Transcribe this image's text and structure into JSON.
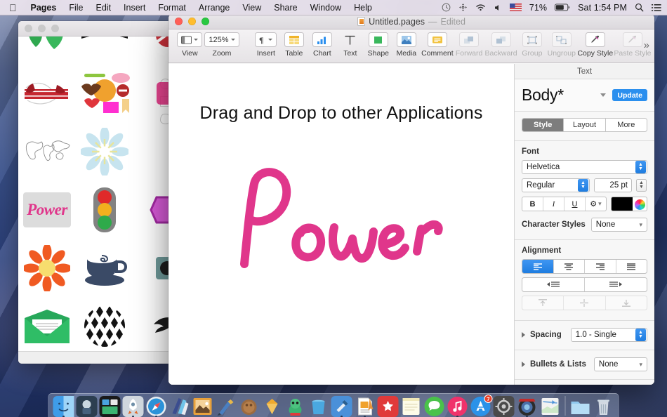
{
  "menubar": {
    "apple_icon": "apple-icon",
    "items": [
      {
        "label": "Pages",
        "bold": true
      },
      {
        "label": "File",
        "bold": false
      },
      {
        "label": "Edit",
        "bold": false
      },
      {
        "label": "Insert",
        "bold": false
      },
      {
        "label": "Format",
        "bold": false
      },
      {
        "label": "Arrange",
        "bold": false
      },
      {
        "label": "View",
        "bold": false
      },
      {
        "label": "Share",
        "bold": false
      },
      {
        "label": "Window",
        "bold": false
      },
      {
        "label": "Help",
        "bold": false
      }
    ],
    "status": {
      "timemachine_icon": "time-machine-icon",
      "sync_icon": "sync-icon",
      "wifi_icon": "wifi-icon",
      "volume_icon": "volume-icon",
      "flag_icon": "us-flag-icon",
      "battery_percent": "71%",
      "battery_icon": "battery-icon",
      "clock": "Sat 1:54 PM",
      "search_icon": "search-icon",
      "notifications_icon": "notification-list-icon"
    }
  },
  "clipart_window": {
    "title": "",
    "items": [
      {
        "name": "green-leaves-clipart"
      },
      {
        "name": "discount-banner-clipart"
      },
      {
        "name": "red-ribbon-clipart"
      },
      {
        "name": "badges-labels-clipart"
      },
      {
        "name": "world-map-outline-clipart"
      },
      {
        "name": "light-blue-flower-clipart"
      },
      {
        "name": "power-script-clipart",
        "selected": true
      },
      {
        "name": "traffic-light-clipart"
      },
      {
        "name": "orange-flower-clipart"
      },
      {
        "name": "coffee-cup-clipart"
      },
      {
        "name": "green-envelope-clipart"
      },
      {
        "name": "checkered-sphere-clipart"
      }
    ]
  },
  "pages_window": {
    "title": {
      "filename": "Untitled.pages",
      "dash": "—",
      "state": "Edited"
    },
    "toolbar": {
      "items": [
        {
          "label": "View",
          "icon": "view-panels-icon",
          "type": "menu",
          "enabled": true
        },
        {
          "label": "Zoom",
          "icon": "zoom-value",
          "type": "menu",
          "enabled": true,
          "value": "125%"
        },
        {
          "label": "Insert",
          "icon": "paragraph-icon",
          "type": "menu",
          "enabled": true
        },
        {
          "label": "Table",
          "icon": "table-icon",
          "type": "button",
          "enabled": true
        },
        {
          "label": "Chart",
          "icon": "chart-bar-icon",
          "type": "button",
          "enabled": true
        },
        {
          "label": "Text",
          "icon": "text-t-icon",
          "type": "button",
          "enabled": true
        },
        {
          "label": "Shape",
          "icon": "shape-square-icon",
          "type": "button",
          "enabled": true
        },
        {
          "label": "Media",
          "icon": "media-photo-icon",
          "type": "button",
          "enabled": true
        },
        {
          "label": "Comment",
          "icon": "comment-icon",
          "type": "button",
          "enabled": true
        },
        {
          "label": "Forward",
          "icon": "bring-forward-icon",
          "type": "button",
          "enabled": false
        },
        {
          "label": "Backward",
          "icon": "send-backward-icon",
          "type": "button",
          "enabled": false
        },
        {
          "label": "Group",
          "icon": "group-icon",
          "type": "button",
          "enabled": false
        },
        {
          "label": "Ungroup",
          "icon": "ungroup-icon",
          "type": "button",
          "enabled": false
        },
        {
          "label": "Copy Style",
          "icon": "eyedropper-copy-icon",
          "type": "button",
          "enabled": true
        },
        {
          "label": "Paste Style",
          "icon": "eyedropper-paste-icon",
          "type": "button",
          "enabled": false
        }
      ],
      "overflow_label": "»"
    },
    "document": {
      "heading": "Drag and Drop to other Applications",
      "artwork_name": "power-script-artwork",
      "artwork_text": "Power",
      "artwork_color": "#e0368b"
    }
  },
  "inspector": {
    "tab_label": "Text",
    "paragraph_style": "Body*",
    "update_label": "Update",
    "segments": [
      {
        "label": "Style",
        "active": true
      },
      {
        "label": "Layout",
        "active": false
      },
      {
        "label": "More",
        "active": false
      }
    ],
    "font": {
      "section_label": "Font",
      "family": "Helvetica",
      "weight": "Regular",
      "size": "25 pt",
      "bold_label": "B",
      "italic_label": "I",
      "underline_label": "U",
      "options_icon": "gear-icon",
      "color": "#000000",
      "color_wheel_icon": "color-wheel-icon",
      "character_styles_label": "Character Styles",
      "character_styles_value": "None"
    },
    "alignment": {
      "section_label": "Alignment",
      "horizontal": [
        {
          "name": "align-left-button",
          "active": true
        },
        {
          "name": "align-center-button",
          "active": false
        },
        {
          "name": "align-right-button",
          "active": false
        },
        {
          "name": "align-justify-button",
          "active": false
        }
      ],
      "indent": [
        {
          "name": "decrease-indent-button"
        },
        {
          "name": "increase-indent-button"
        }
      ],
      "vertical": [
        {
          "name": "align-top-button"
        },
        {
          "name": "align-middle-button"
        },
        {
          "name": "align-bottom-button"
        }
      ]
    },
    "spacing": {
      "label": "Spacing",
      "value": "1.0 - Single"
    },
    "bullets": {
      "label": "Bullets & Lists",
      "value": "None"
    }
  },
  "dock": {
    "items": [
      {
        "name": "finder",
        "running": true
      },
      {
        "name": "system-app",
        "running": false
      },
      {
        "name": "mission-control",
        "running": false
      },
      {
        "name": "launchpad",
        "running": true
      },
      {
        "name": "safari",
        "running": true
      },
      {
        "name": "books",
        "running": false
      },
      {
        "name": "preview",
        "running": false
      },
      {
        "name": "paint-app",
        "running": false
      },
      {
        "name": "coconut",
        "running": false
      },
      {
        "name": "sketch",
        "running": false
      },
      {
        "name": "yoshi-game",
        "running": false
      },
      {
        "name": "bucket-app",
        "running": false
      },
      {
        "name": "xcode",
        "running": true
      },
      {
        "name": "pages",
        "running": true
      },
      {
        "name": "wunderlist",
        "running": false
      },
      {
        "name": "notes",
        "running": false
      },
      {
        "name": "messages",
        "running": false
      },
      {
        "name": "itunes",
        "running": true
      },
      {
        "name": "app-store",
        "running": false,
        "badge": "7"
      },
      {
        "name": "system-preferences",
        "running": false
      },
      {
        "name": "camera-app",
        "running": true
      },
      {
        "name": "maps",
        "running": false
      }
    ],
    "folder_name": "downloads-folder",
    "trash_name": "trash"
  },
  "colors": {
    "accent_blue": "#2b8fee",
    "pink": "#e0368b",
    "menubar_bg": "#ece4ee",
    "inspector_bg": "#f7f7f7"
  }
}
